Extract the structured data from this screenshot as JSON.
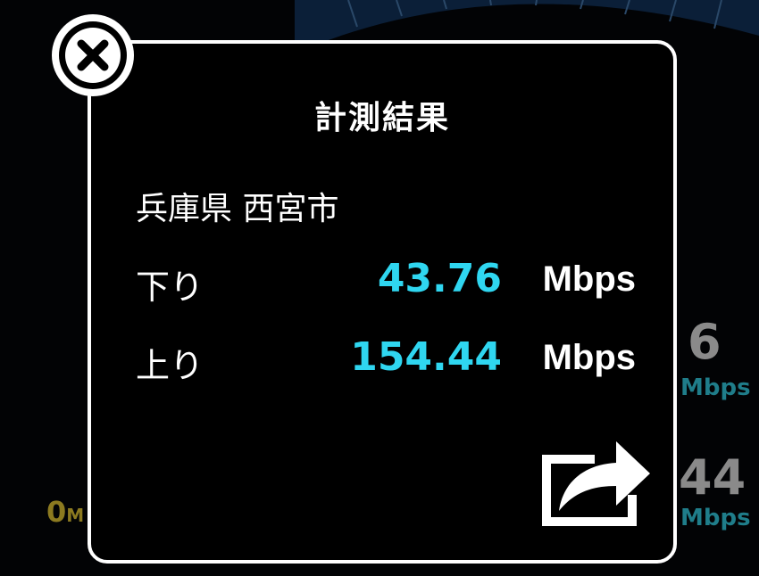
{
  "modal": {
    "title": "計測結果",
    "location": "兵庫県 西宮市",
    "download": {
      "label": "下り",
      "value": "43.76",
      "unit": "Mbps"
    },
    "upload": {
      "label": "上り",
      "value": "154.44",
      "unit": "Mbps"
    }
  },
  "background": {
    "download_partial_value": "6",
    "download_partial_unit": "Mbps",
    "upload_partial_value": "44",
    "upload_partial_unit": "Mbps",
    "gauge_min_value": "0",
    "gauge_min_unit": "M"
  },
  "colors": {
    "accent_value": "#2fd6f0",
    "modal_bg": "#000000",
    "modal_border": "#ffffff",
    "gauge_min_color": "#8c7a20"
  },
  "icons": {
    "close": "close-icon",
    "share": "share-icon"
  }
}
